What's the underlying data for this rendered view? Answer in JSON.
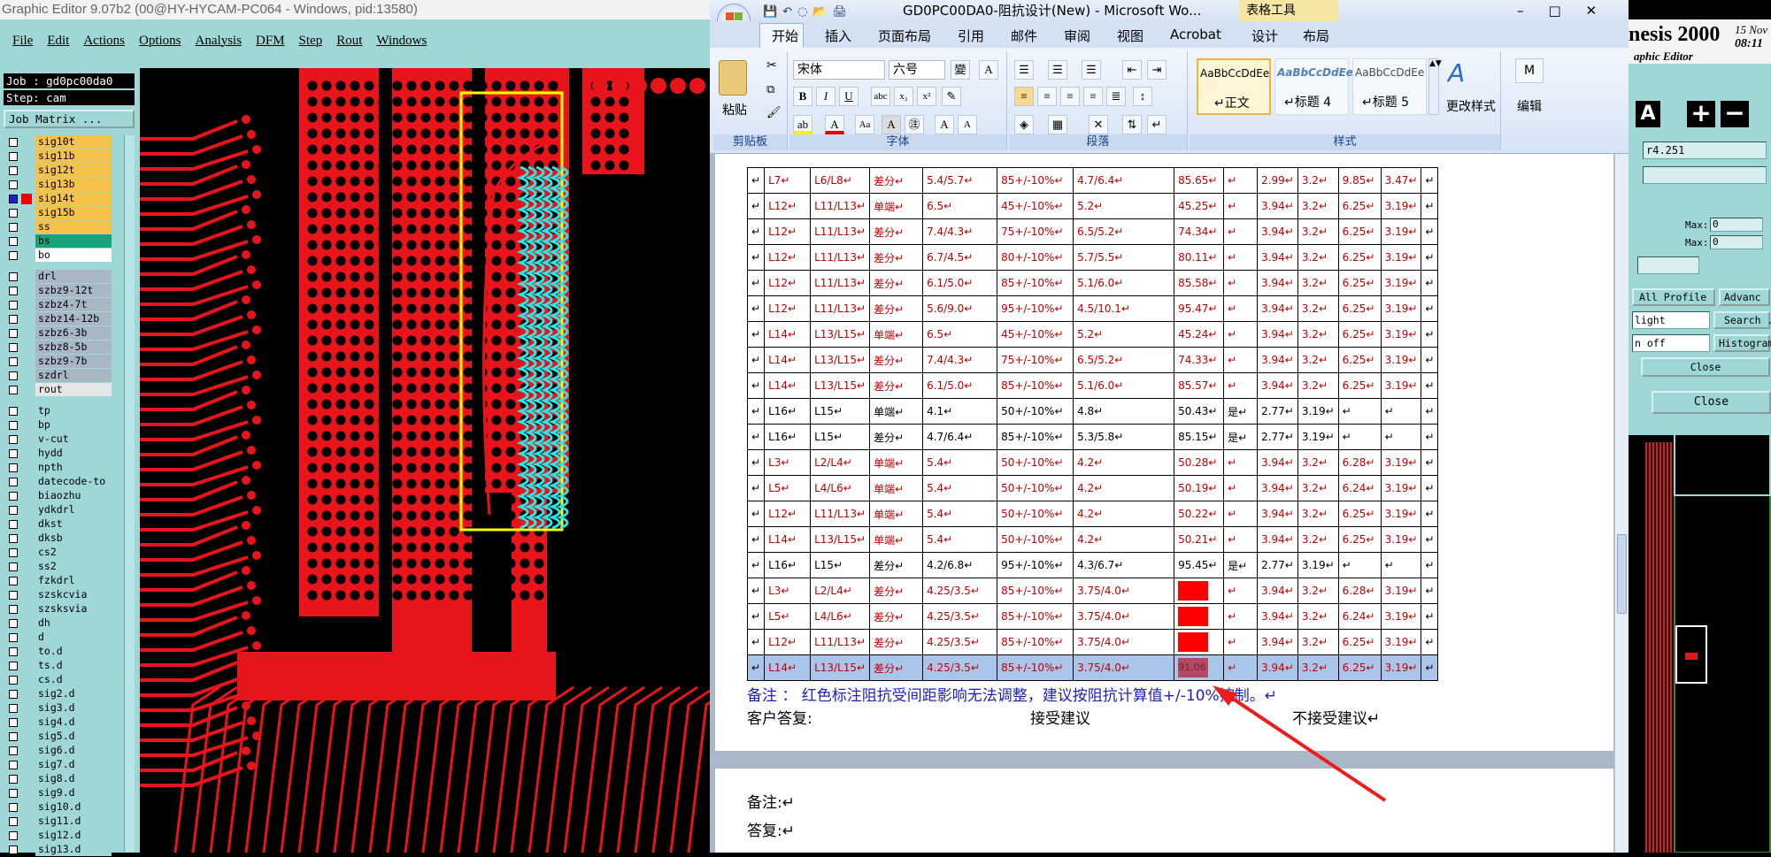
{
  "genesis": {
    "title": "Graphic Editor 9.07b2 (00@HY-HYCAM-PC064 - Windows, pid:13580)",
    "menu": [
      "File",
      "Edit",
      "Actions",
      "Options",
      "Analysis",
      "DFM",
      "Step",
      "Rout",
      "Windows"
    ],
    "job_label": "Job : gd0pc00da0",
    "step_label": "Step: cam",
    "job_matrix_button": "Job Matrix ...",
    "layers": [
      {
        "name": "sig10t",
        "color": "#f6c24b"
      },
      {
        "name": "sig11b",
        "color": "#f6c24b"
      },
      {
        "name": "sig12t",
        "color": "#f6c24b"
      },
      {
        "name": "sig13b",
        "color": "#f6c24b"
      },
      {
        "name": "sig14t",
        "color": "#f6c24b",
        "active": true
      },
      {
        "name": "sig15b",
        "color": "#f6c24b"
      },
      {
        "name": "ss",
        "color": "#f6c24b"
      },
      {
        "name": "bs",
        "color": "#1aa37a"
      },
      {
        "name": "bo",
        "color": "#ffffff"
      },
      {
        "name": "drl",
        "color": "#a9b6c4"
      },
      {
        "name": "szbz9-12t",
        "color": "#a9b6c4"
      },
      {
        "name": "szbz4-7t",
        "color": "#a9b6c4"
      },
      {
        "name": "szbz14-12b",
        "color": "#a9b6c4"
      },
      {
        "name": "szbz6-3b",
        "color": "#a9b6c4"
      },
      {
        "name": "szbz8-5b",
        "color": "#a9b6c4"
      },
      {
        "name": "szbz9-7b",
        "color": "#a9b6c4"
      },
      {
        "name": "szdrl",
        "color": "#a9b6c4"
      },
      {
        "name": "rout",
        "color": "#e6e6e6"
      },
      {
        "name": "tp",
        "color": "#9fd6d6"
      },
      {
        "name": "bp",
        "color": "#9fd6d6"
      },
      {
        "name": "v-cut",
        "color": "#9fd6d6"
      },
      {
        "name": "hydd",
        "color": "#9fd6d6"
      },
      {
        "name": "npth",
        "color": "#9fd6d6"
      },
      {
        "name": "datecode-to",
        "color": "#9fd6d6"
      },
      {
        "name": "biaozhu",
        "color": "#9fd6d6"
      },
      {
        "name": "ydkdrl",
        "color": "#9fd6d6"
      },
      {
        "name": "dkst",
        "color": "#9fd6d6"
      },
      {
        "name": "dksb",
        "color": "#9fd6d6"
      },
      {
        "name": "cs2",
        "color": "#9fd6d6"
      },
      {
        "name": "ss2",
        "color": "#9fd6d6"
      },
      {
        "name": "fzkdrl",
        "color": "#9fd6d6"
      },
      {
        "name": "szskcvia",
        "color": "#9fd6d6"
      },
      {
        "name": "szsksvia",
        "color": "#9fd6d6"
      },
      {
        "name": "dh",
        "color": "#9fd6d6"
      },
      {
        "name": "d",
        "color": "#9fd6d6"
      },
      {
        "name": "to.d",
        "color": "#9fd6d6"
      },
      {
        "name": "ts.d",
        "color": "#9fd6d6"
      },
      {
        "name": "cs.d",
        "color": "#9fd6d6"
      },
      {
        "name": "sig2.d",
        "color": "#9fd6d6"
      },
      {
        "name": "sig3.d",
        "color": "#9fd6d6"
      },
      {
        "name": "sig4.d",
        "color": "#9fd6d6"
      },
      {
        "name": "sig5.d",
        "color": "#9fd6d6"
      },
      {
        "name": "sig6.d",
        "color": "#9fd6d6"
      },
      {
        "name": "sig7.d",
        "color": "#9fd6d6"
      },
      {
        "name": "sig8.d",
        "color": "#9fd6d6"
      },
      {
        "name": "sig9.d",
        "color": "#9fd6d6"
      },
      {
        "name": "sig10.d",
        "color": "#9fd6d6"
      },
      {
        "name": "sig11.d",
        "color": "#9fd6d6"
      },
      {
        "name": "sig12.d",
        "color": "#9fd6d6"
      },
      {
        "name": "sig13.d",
        "color": "#9fd6d6"
      }
    ],
    "right": {
      "brand": "nesis 2000",
      "subtitle": "aphic Editor",
      "date": "15 Nov",
      "time": "08:11",
      "field_value": "r4.251",
      "max_label": "Max:",
      "max_value": "0",
      "all_profile": "All Profile",
      "advanced": "Advanc",
      "highlight": "light",
      "search": "Search .",
      "off": "n off",
      "histogram": "Histogram",
      "close1": "Close",
      "close2": "Close"
    }
  },
  "word": {
    "title": "GD0PC00DA0-阻抗设计(New) - Microsoft Wo...",
    "tool_tab": "表格工具",
    "tabs": [
      "开始",
      "插入",
      "页面布局",
      "引用",
      "邮件",
      "审阅",
      "视图",
      "Acrobat",
      "设计",
      "布局"
    ],
    "ribbon": {
      "paste": "粘贴",
      "clipboard": "剪贴板",
      "font_name": "宋体",
      "font_size": "六号",
      "font_group": "字体",
      "paragraph_group": "段落",
      "styles_group": "样式",
      "styles": [
        {
          "preview": "AaBbCcDdEe",
          "name": "↵正文"
        },
        {
          "preview": "AaBbCcDdEe",
          "name": "↵标题 4"
        },
        {
          "preview": "AaBbCcDdEe",
          "name": "↵标题 5"
        }
      ],
      "change_styles": "更改样式",
      "edit": "编辑"
    },
    "table": [
      [
        "↵",
        "L7↵",
        "L6/L8↵",
        "差分↵",
        "5.4/5.7↵",
        "85+/-10%↵",
        "4.7/6.4↵",
        "85.65↵",
        "↵",
        "2.99↵",
        "3.2↵",
        "9.85↵",
        "3.47↵",
        "↵"
      ],
      [
        "↵",
        "L12↵",
        "L11/L13↵",
        "单端↵",
        "6.5↵",
        "45+/-10%↵",
        "5.2↵",
        "45.25↵",
        "↵",
        "3.94↵",
        "3.2↵",
        "6.25↵",
        "3.19↵",
        "↵"
      ],
      [
        "↵",
        "L12↵",
        "L11/L13↵",
        "差分↵",
        "7.4/4.3↵",
        "75+/-10%↵",
        "6.5/5.2↵",
        "74.34↵",
        "↵",
        "3.94↵",
        "3.2↵",
        "6.25↵",
        "3.19↵",
        "↵"
      ],
      [
        "↵",
        "L12↵",
        "L11/L13↵",
        "差分↵",
        "6.7/4.5↵",
        "80+/-10%↵",
        "5.7/5.5↵",
        "80.11↵",
        "↵",
        "3.94↵",
        "3.2↵",
        "6.25↵",
        "3.19↵",
        "↵"
      ],
      [
        "↵",
        "L12↵",
        "L11/L13↵",
        "差分↵",
        "6.1/5.0↵",
        "85+/-10%↵",
        "5.1/6.0↵",
        "85.58↵",
        "↵",
        "3.94↵",
        "3.2↵",
        "6.25↵",
        "3.19↵",
        "↵"
      ],
      [
        "↵",
        "L12↵",
        "L11/L13↵",
        "差分↵",
        "5.6/9.0↵",
        "95+/-10%↵",
        "4.5/10.1↵",
        "95.47↵",
        "↵",
        "3.94↵",
        "3.2↵",
        "6.25↵",
        "3.19↵",
        "↵"
      ],
      [
        "↵",
        "L14↵",
        "L13/L15↵",
        "单端↵",
        "6.5↵",
        "45+/-10%↵",
        "5.2↵",
        "45.24↵",
        "↵",
        "3.94↵",
        "3.2↵",
        "6.25↵",
        "3.19↵",
        "↵"
      ],
      [
        "↵",
        "L14↵",
        "L13/L15↵",
        "差分↵",
        "7.4/4.3↵",
        "75+/-10%↵",
        "6.5/5.2↵",
        "74.33↵",
        "↵",
        "3.94↵",
        "3.2↵",
        "6.25↵",
        "3.19↵",
        "↵"
      ],
      [
        "↵",
        "L14↵",
        "L13/L15↵",
        "差分↵",
        "6.1/5.0↵",
        "85+/-10%↵",
        "5.1/6.0↵",
        "85.57↵",
        "↵",
        "3.94↵",
        "3.2↵",
        "6.25↵",
        "3.19↵",
        "↵"
      ],
      [
        "↵",
        "L16↵",
        "L15↵",
        "单端↵",
        "4.1↵",
        "50+/-10%↵",
        "4.8↵",
        "50.43↵",
        "是↵",
        "2.77↵",
        "3.19↵",
        "↵",
        "↵",
        "↵"
      ],
      [
        "↵",
        "L16↵",
        "L15↵",
        "差分↵",
        "4.7/6.4↵",
        "85+/-10%↵",
        "5.3/5.8↵",
        "85.15↵",
        "是↵",
        "2.77↵",
        "3.19↵",
        "↵",
        "↵",
        "↵"
      ],
      [
        "↵",
        "L3↵",
        "L2/L4↵",
        "单端↵",
        "5.4↵",
        "50+/-10%↵",
        "4.2↵",
        "50.28↵",
        "↵",
        "3.94↵",
        "3.2↵",
        "6.28↵",
        "3.19↵",
        "↵"
      ],
      [
        "↵",
        "L5↵",
        "L4/L6↵",
        "单端↵",
        "5.4↵",
        "50+/-10%↵",
        "4.2↵",
        "50.19↵",
        "↵",
        "3.94↵",
        "3.2↵",
        "6.24↵",
        "3.19↵",
        "↵"
      ],
      [
        "↵",
        "L12↵",
        "L11/L13↵",
        "单端↵",
        "5.4↵",
        "50+/-10%↵",
        "4.2↵",
        "50.22↵",
        "↵",
        "3.94↵",
        "3.2↵",
        "6.25↵",
        "3.19↵",
        "↵"
      ],
      [
        "↵",
        "L14↵",
        "L13/L15↵",
        "单端↵",
        "5.4↵",
        "50+/-10%↵",
        "4.2↵",
        "50.21↵",
        "↵",
        "3.94↵",
        "3.2↵",
        "6.25↵",
        "3.19↵",
        "↵"
      ],
      [
        "↵",
        "L16↵",
        "L15↵",
        "差分↵",
        "4.2/6.8↵",
        "95+/-10%↵",
        "4.3/6.7↵",
        "95.45↵",
        "是↵",
        "2.77↵",
        "3.19↵",
        "↵",
        "↵",
        "↵"
      ],
      [
        "↵",
        "L3↵",
        "L2/L4↵",
        "差分↵",
        "4.25/3.5↵",
        "85+/-10%↵",
        "3.75/4.0↵",
        "",
        "↵",
        "3.94↵",
        "3.2↵",
        "6.28↵",
        "3.19↵",
        "↵"
      ],
      [
        "↵",
        "L5↵",
        "L4/L6↵",
        "差分↵",
        "4.25/3.5↵",
        "85+/-10%↵",
        "3.75/4.0↵",
        "",
        "↵",
        "3.94↵",
        "3.2↵",
        "6.24↵",
        "3.19↵",
        "↵"
      ],
      [
        "↵",
        "L12↵",
        "L11/L13↵",
        "差分↵",
        "4.25/3.5↵",
        "85+/-10%↵",
        "3.75/4.0↵",
        "",
        "↵",
        "3.94↵",
        "3.2↵",
        "6.25↵",
        "3.19↵",
        "↵"
      ],
      [
        "↵",
        "L14↵",
        "L13/L15↵",
        "差分↵",
        "4.25/3.5↵",
        "85+/-10%↵",
        "3.75/4.0↵",
        "91.06",
        "↵",
        "3.94↵",
        "3.2↵",
        "6.25↵",
        "3.19↵",
        "↵"
      ]
    ],
    "note": "备注 ： 红色标注阻抗受间距影响无法调整，建议按阻抗计算值+/-10%控制。↵",
    "reply_label": "客户答复:",
    "accept": "接受建议",
    "reject": "不接受建议↵",
    "page2_note": "备注:↵",
    "page2_reply": "答复:↵"
  }
}
